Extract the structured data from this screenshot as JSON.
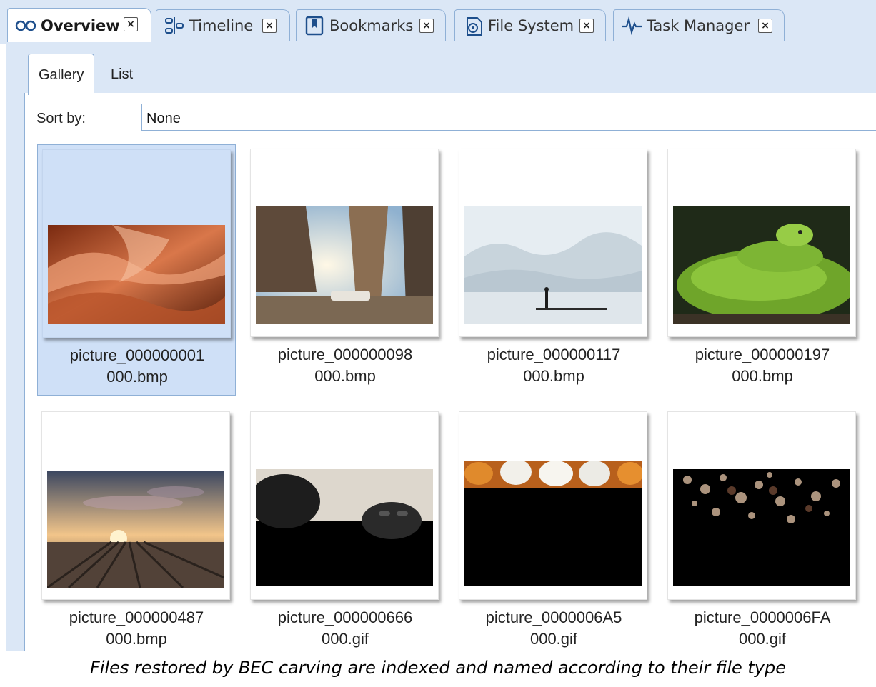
{
  "tabs": [
    {
      "label": "Overview",
      "icon": "glasses-icon",
      "active": true
    },
    {
      "label": "Timeline",
      "icon": "timeline-icon",
      "active": false
    },
    {
      "label": "Bookmarks",
      "icon": "bookmark-icon",
      "active": false
    },
    {
      "label": "File System",
      "icon": "file-system-icon",
      "active": false
    },
    {
      "label": "Task Manager",
      "icon": "pulse-icon",
      "active": false
    }
  ],
  "close_glyph": "×",
  "view_tabs": [
    {
      "label": "Gallery",
      "active": true
    },
    {
      "label": "List",
      "active": false
    }
  ],
  "sort": {
    "label": "Sort by:",
    "value": "None"
  },
  "gallery": [
    {
      "line1": "picture_000000001",
      "line2": "000.bmp",
      "selected": true,
      "image": "canyon"
    },
    {
      "line1": "picture_000000098",
      "line2": "000.bmp",
      "selected": false,
      "image": "street"
    },
    {
      "line1": "picture_000000117",
      "line2": "000.bmp",
      "selected": false,
      "image": "misty-lake"
    },
    {
      "line1": "picture_000000197",
      "line2": "000.bmp",
      "selected": false,
      "image": "green-snake"
    },
    {
      "line1": "picture_000000487",
      "line2": "000.bmp",
      "selected": false,
      "image": "rail-yard-sunset"
    },
    {
      "line1": "picture_000000666",
      "line2": "000.gif",
      "selected": false,
      "image": "gorilla-partial"
    },
    {
      "line1": "picture_0000006A5",
      "line2": "000.gif",
      "selected": false,
      "image": "pumpkins-partial"
    },
    {
      "line1": "picture_0000006FA",
      "line2": "000.gif",
      "selected": false,
      "image": "flowers-partial"
    }
  ],
  "footer": {
    "line1": "Files restored by BEC carving are indexed and named according to their file type"
  },
  "colors": {
    "accent_border": "#8fb0d6",
    "panel_bg": "#dbe7f6",
    "selection": "#cfe0f7"
  }
}
